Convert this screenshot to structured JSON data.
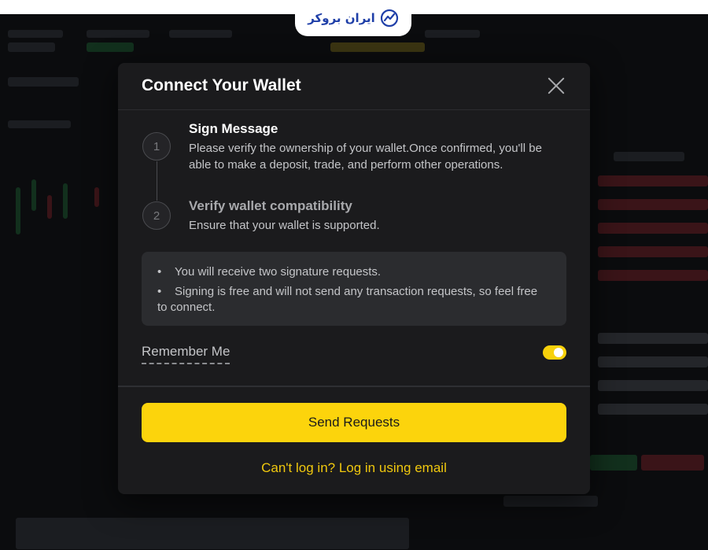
{
  "brand": {
    "name": "ایران بروکر"
  },
  "modal": {
    "title": "Connect Your Wallet",
    "steps": [
      {
        "number": "1",
        "title": "Sign Message",
        "desc_line1": "Please verify the ownership of your wallet.Once confirmed, you'll be",
        "desc_line2": "able to make a deposit, trade, and perform other operations."
      },
      {
        "number": "2",
        "title": "Verify wallet compatibility",
        "desc": "Ensure that your wallet is supported."
      }
    ],
    "info": {
      "bullet1": "You will receive two signature requests.",
      "bullet2_line1": "Signing is free and will not send any transaction requests, so feel free",
      "bullet2_line2": "to connect."
    },
    "remember_me": {
      "label": "Remember Me",
      "enabled": true
    },
    "send_button": "Send Requests",
    "email_link": "Can't log in? Log in using email"
  },
  "colors": {
    "accent": "#fcd40c",
    "link": "#f0c80e",
    "modal_bg": "#1b1b1d",
    "brand": "#1f3fa8"
  }
}
